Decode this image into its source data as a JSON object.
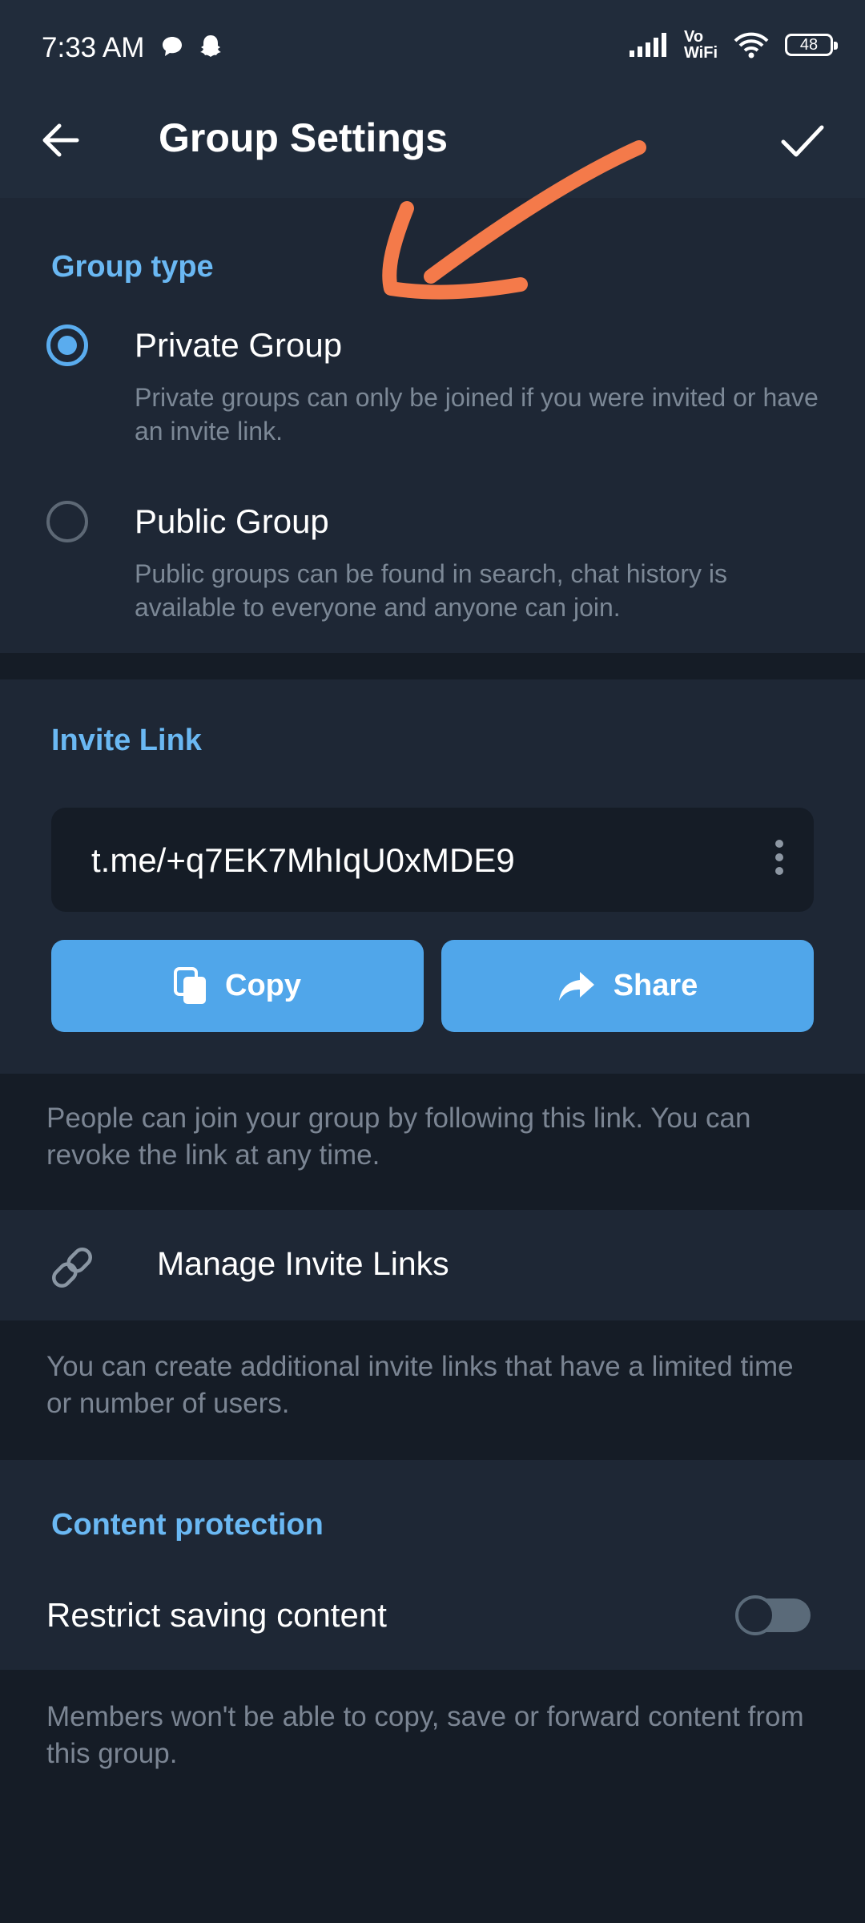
{
  "status_bar": {
    "time": "7:33 AM",
    "volte_top": "Vo",
    "volte_bottom": "WiFi",
    "battery": "48"
  },
  "app_bar": {
    "title": "Group Settings"
  },
  "group_type": {
    "header": "Group type",
    "options": [
      {
        "title": "Private Group",
        "description": "Private groups can only be joined if you were invited or have an invite link.",
        "selected": true
      },
      {
        "title": "Public Group",
        "description": "Public groups can be found in search, chat history is available to everyone and anyone can join.",
        "selected": false
      }
    ]
  },
  "invite_link": {
    "header": "Invite Link",
    "link": "t.me/+q7EK7MhIqU0xMDE9",
    "copy_label": "Copy",
    "share_label": "Share",
    "info": "People can join your group by following this link. You can revoke the link at any time."
  },
  "manage_links": {
    "label": "Manage Invite Links",
    "info": "You can create additional invite links that have a limited time or number of users."
  },
  "content_protection": {
    "header": "Content protection",
    "restrict_label": "Restrict saving content",
    "restrict_enabled": false,
    "info": "Members won't be able to copy, save or forward content from this group."
  },
  "colors": {
    "accent": "#50a6ea",
    "section_header": "#6ab8f3",
    "annotation_arrow": "#f47a4a"
  }
}
